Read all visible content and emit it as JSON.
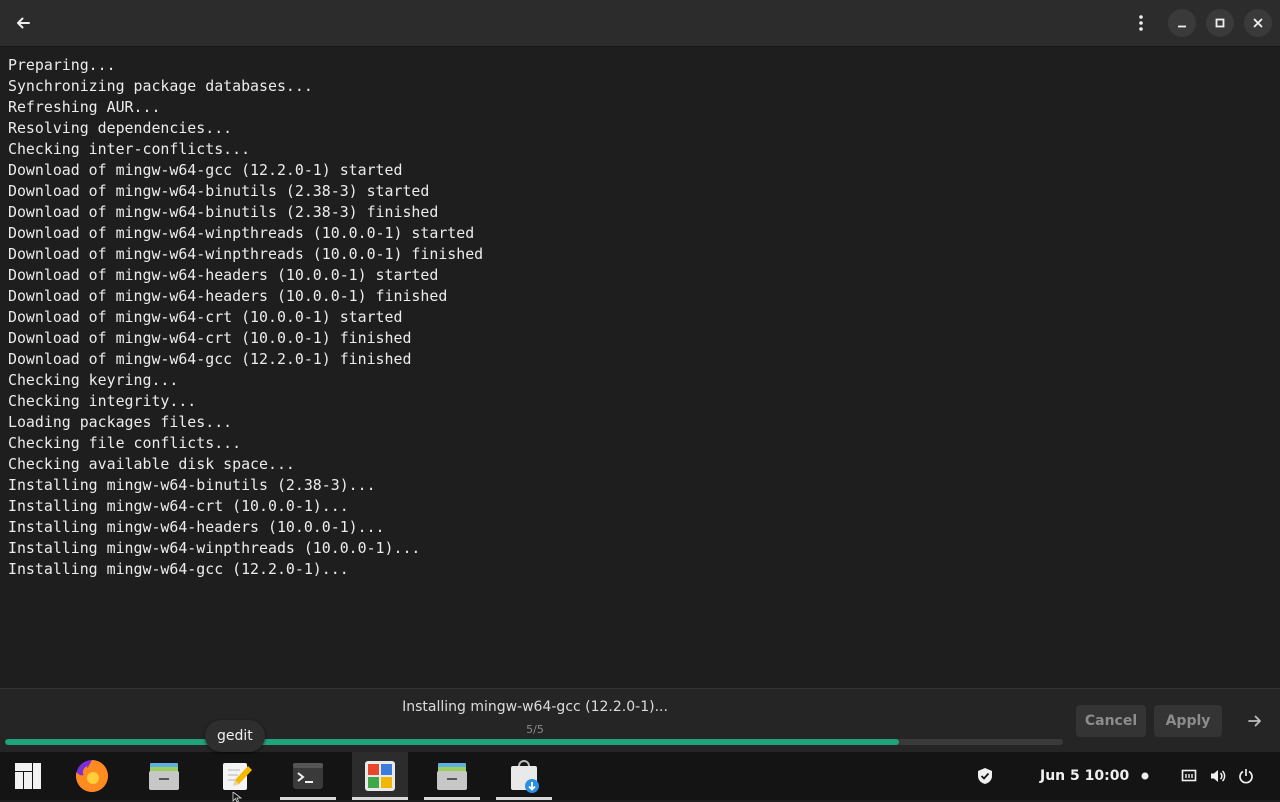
{
  "header": {
    "back_icon": "arrow-left-icon",
    "menu_icon": "vertical-dots-icon",
    "minimize_icon": "minimize-icon",
    "maximize_icon": "maximize-icon",
    "close_icon": "close-icon"
  },
  "log": {
    "lines": [
      "Preparing...",
      "Synchronizing package databases...",
      "Refreshing AUR...",
      "Resolving dependencies...",
      "Checking inter-conflicts...",
      "Download of mingw-w64-gcc (12.2.0-1) started",
      "Download of mingw-w64-binutils (2.38-3) started",
      "Download of mingw-w64-binutils (2.38-3) finished",
      "Download of mingw-w64-winpthreads (10.0.0-1) started",
      "Download of mingw-w64-winpthreads (10.0.0-1) finished",
      "Download of mingw-w64-headers (10.0.0-1) started",
      "Download of mingw-w64-headers (10.0.0-1) finished",
      "Download of mingw-w64-crt (10.0.0-1) started",
      "Download of mingw-w64-crt (10.0.0-1) finished",
      "Download of mingw-w64-gcc (12.2.0-1) finished",
      "Checking keyring...",
      "Checking integrity...",
      "Loading packages files...",
      "Checking file conflicts...",
      "Checking available disk space...",
      "Installing mingw-w64-binutils (2.38-3)...",
      "Installing mingw-w64-crt (10.0.0-1)...",
      "Installing mingw-w64-headers (10.0.0-1)...",
      "Installing mingw-w64-winpthreads (10.0.0-1)...",
      "Installing mingw-w64-gcc (12.2.0-1)..."
    ]
  },
  "progress": {
    "status": "Installing mingw-w64-gcc (12.2.0-1)...",
    "step": "5/5",
    "fraction": 0.845,
    "cancel_label": "Cancel",
    "apply_label": "Apply",
    "next_icon": "arrow-right-icon",
    "accent_color": "#1fa37a"
  },
  "tooltip": {
    "text": "gedit"
  },
  "taskbar": {
    "apps": [
      {
        "name": "app-menu",
        "icon": "manjaro-logo-icon",
        "active": false,
        "running": false
      },
      {
        "name": "firefox",
        "icon": "firefox-icon",
        "active": false,
        "running": false
      },
      {
        "name": "files",
        "icon": "file-manager-icon",
        "active": false,
        "running": false
      },
      {
        "name": "gedit",
        "icon": "text-editor-icon",
        "active": false,
        "running": false
      },
      {
        "name": "terminal",
        "icon": "terminal-icon",
        "active": false,
        "running": true
      },
      {
        "name": "settings-manager",
        "icon": "settings-manager-icon",
        "active": true,
        "running": true
      },
      {
        "name": "files-2",
        "icon": "file-manager-icon",
        "active": false,
        "running": true
      },
      {
        "name": "software",
        "icon": "package-manager-icon",
        "active": false,
        "running": true
      }
    ],
    "tray": {
      "shield_icon": "shield-check-icon",
      "clock": "Jun 5  10:00",
      "notification_icon": "notification-dot-icon",
      "network_icon": "wired-network-icon",
      "volume_icon": "volume-icon",
      "power_icon": "power-icon"
    }
  }
}
